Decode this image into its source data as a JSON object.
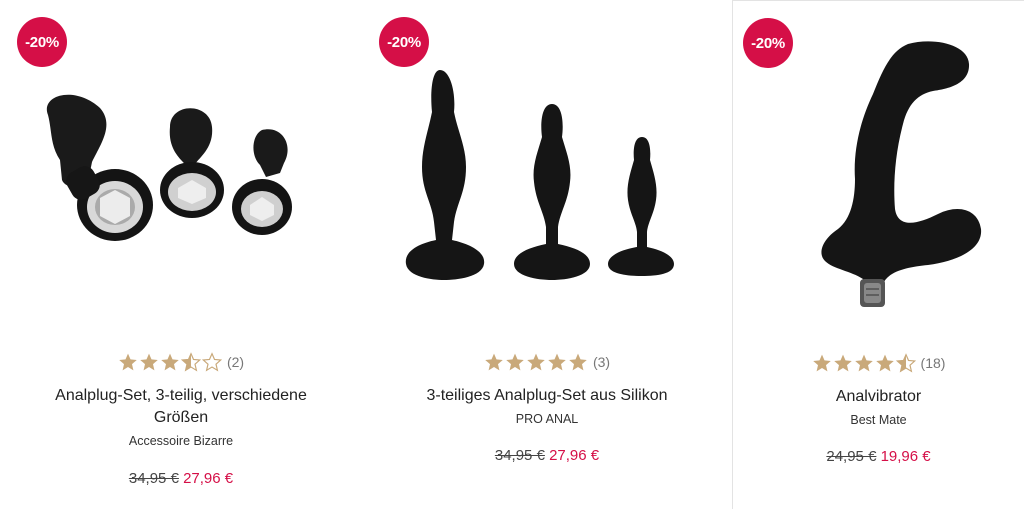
{
  "colors": {
    "badge": "#d50f47",
    "star": "#c9a97a",
    "sale_price": "#d50f47"
  },
  "products": [
    {
      "discount": "-20%",
      "image": "analplug-set-jewel-icon",
      "rating": 3.5,
      "review_count": "(2)",
      "title": "Analplug-Set, 3-teilig, verschiedene Größen",
      "brand": "Accessoire Bizarre",
      "old_price": "34,95 €",
      "new_price": "27,96 €"
    },
    {
      "discount": "-20%",
      "image": "silicone-plug-set-icon",
      "rating": 5,
      "review_count": "(3)",
      "title": "3-teiliges Analplug-Set aus Silikon",
      "brand": "PRO ANAL",
      "old_price": "34,95 €",
      "new_price": "27,96 €"
    },
    {
      "discount": "-20%",
      "image": "anal-vibrator-icon",
      "rating": 4.5,
      "review_count": "(18)",
      "title": "Analvibrator",
      "brand": "Best Mate",
      "old_price": "24,95 €",
      "new_price": "19,96 €"
    }
  ]
}
